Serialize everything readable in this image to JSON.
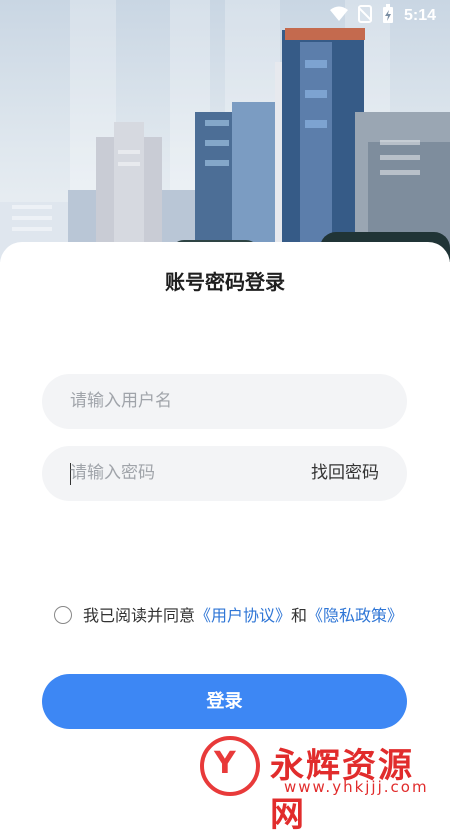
{
  "status_bar": {
    "time": "5:14"
  },
  "page": {
    "title": "账号密码登录"
  },
  "username": {
    "placeholder": "请输入用户名"
  },
  "password": {
    "placeholder": "请输入密码",
    "forgot_label": "找回密码"
  },
  "agreement": {
    "prefix": "我已阅读并同意",
    "user_agreement": "《用户协议》",
    "and": "和",
    "privacy_policy": "《隐私政策》"
  },
  "login_button": {
    "label": "登录"
  },
  "watermark": {
    "name": "永辉资源网",
    "url": "www.yhkjjj.com"
  },
  "colors": {
    "accent": "#3d87f4",
    "link": "#2f76d6",
    "field_bg": "#f3f4f6",
    "watermark": "#e12c2c"
  }
}
